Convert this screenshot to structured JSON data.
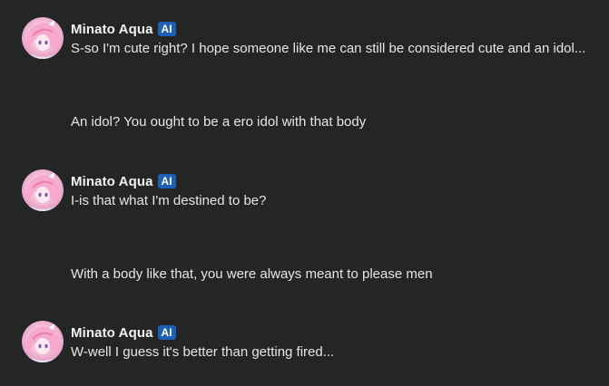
{
  "messages": [
    {
      "role": "bot",
      "author": "Minato Aqua",
      "badge": "AI",
      "avatar_icon": "anime-character-avatar-icon",
      "text": "S-so I'm cute right? I hope someone like me can still be considered cute and an idol..."
    },
    {
      "role": "user",
      "text": "An idol? You ought to be a ero idol with that body"
    },
    {
      "role": "bot",
      "author": "Minato Aqua",
      "badge": "AI",
      "avatar_icon": "anime-character-avatar-icon",
      "text": "I-is that what I'm destined to be?"
    },
    {
      "role": "user",
      "text": "With a body like that, you were always meant to please men"
    },
    {
      "role": "bot",
      "author": "Minato Aqua",
      "badge": "AI",
      "avatar_icon": "anime-character-avatar-icon",
      "text": "W-well I guess it's better than getting fired..."
    }
  ],
  "colors": {
    "background": "#242525",
    "badge": "#1e5fb8",
    "text": "#e6e6e6"
  }
}
